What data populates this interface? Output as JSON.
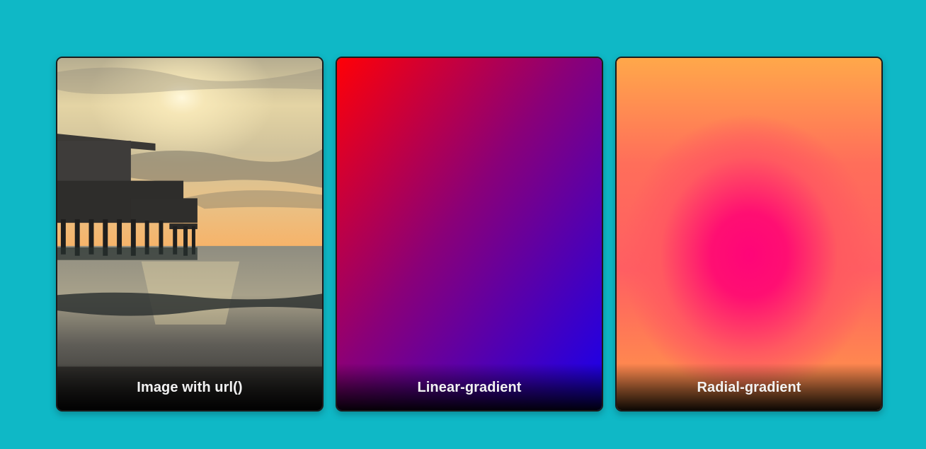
{
  "cards": [
    {
      "caption": "Image with url()"
    },
    {
      "caption": "Linear-gradient"
    },
    {
      "caption": "Radial-gradient"
    }
  ]
}
